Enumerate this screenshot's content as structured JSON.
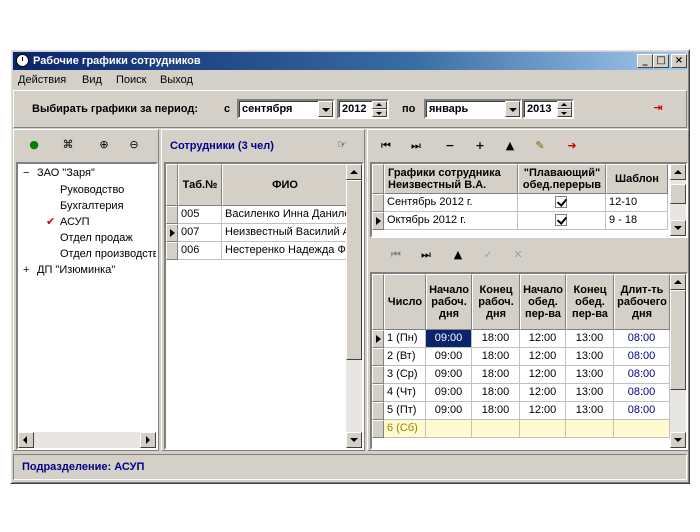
{
  "window": {
    "title": "Рабочие графики сотрудников",
    "min": "_",
    "max": "□",
    "close": "×"
  },
  "menu": [
    "Действия",
    "Вид",
    "Поиск",
    "Выход"
  ],
  "period": {
    "label": "Выбирать графики за период:",
    "from_label": "с",
    "from_month": "сентября",
    "from_year": "2012",
    "to_label": "по",
    "to_month": "январь",
    "to_year": "2013"
  },
  "tree": [
    {
      "label": "ЗАО \"Заря\"",
      "expander": "−"
    },
    {
      "label": "Руководство"
    },
    {
      "label": "Бухгалтерия"
    },
    {
      "label": "АСУП",
      "checked": true
    },
    {
      "label": "Отдел продаж"
    },
    {
      "label": "Отдел производства"
    },
    {
      "label": "ДП \"Изюминка\"",
      "expander": "+"
    }
  ],
  "employees": {
    "title": "Сотрудники (3 чел)",
    "columns": [
      "Таб.№",
      "ФИО"
    ],
    "rows": [
      {
        "tab": "005",
        "name": "Василенко Инна Даниловна"
      },
      {
        "tab": "007",
        "name": "Неизвестный Василий А."
      },
      {
        "tab": "006",
        "name": "Нестеренко Надежда Ф."
      }
    ]
  },
  "schedules": {
    "col1": "Графики сотрудника Неизвестный В.А.",
    "col2": "\"Плавающий\" обед.перерыв",
    "col3": "Шаблон",
    "rows": [
      {
        "name": "Сентябрь 2012 г.",
        "float": true,
        "template": "12-10"
      },
      {
        "name": "Октябрь 2012 г.",
        "float": true,
        "template": "9 - 18"
      }
    ]
  },
  "days": {
    "columns": [
      "Число",
      "Начало рабоч. дня",
      "Конец рабоч. дня",
      "Начало обед. пер-ва",
      "Конец обед. пер-ва",
      "Длит-ть рабочего дня"
    ],
    "rows": [
      [
        "1 (Пн)",
        "09:00",
        "18:00",
        "12:00",
        "13:00",
        "08:00"
      ],
      [
        "2 (Вт)",
        "09:00",
        "18:00",
        "12:00",
        "13:00",
        "08:00"
      ],
      [
        "3 (Ср)",
        "09:00",
        "18:00",
        "12:00",
        "13:00",
        "08:00"
      ],
      [
        "4 (Чт)",
        "09:00",
        "18:00",
        "12:00",
        "13:00",
        "08:00"
      ],
      [
        "5 (Пт)",
        "09:00",
        "18:00",
        "12:00",
        "13:00",
        "08:00"
      ],
      [
        "6 (Сб)",
        "",
        "",
        "",
        "",
        ""
      ]
    ]
  },
  "status": {
    "text": "Подразделение: АСУП"
  },
  "colors": {
    "titlebar": "#0a246a",
    "accent": "#00008b",
    "weekend": "#fffbd0",
    "check": "#cc0000"
  }
}
